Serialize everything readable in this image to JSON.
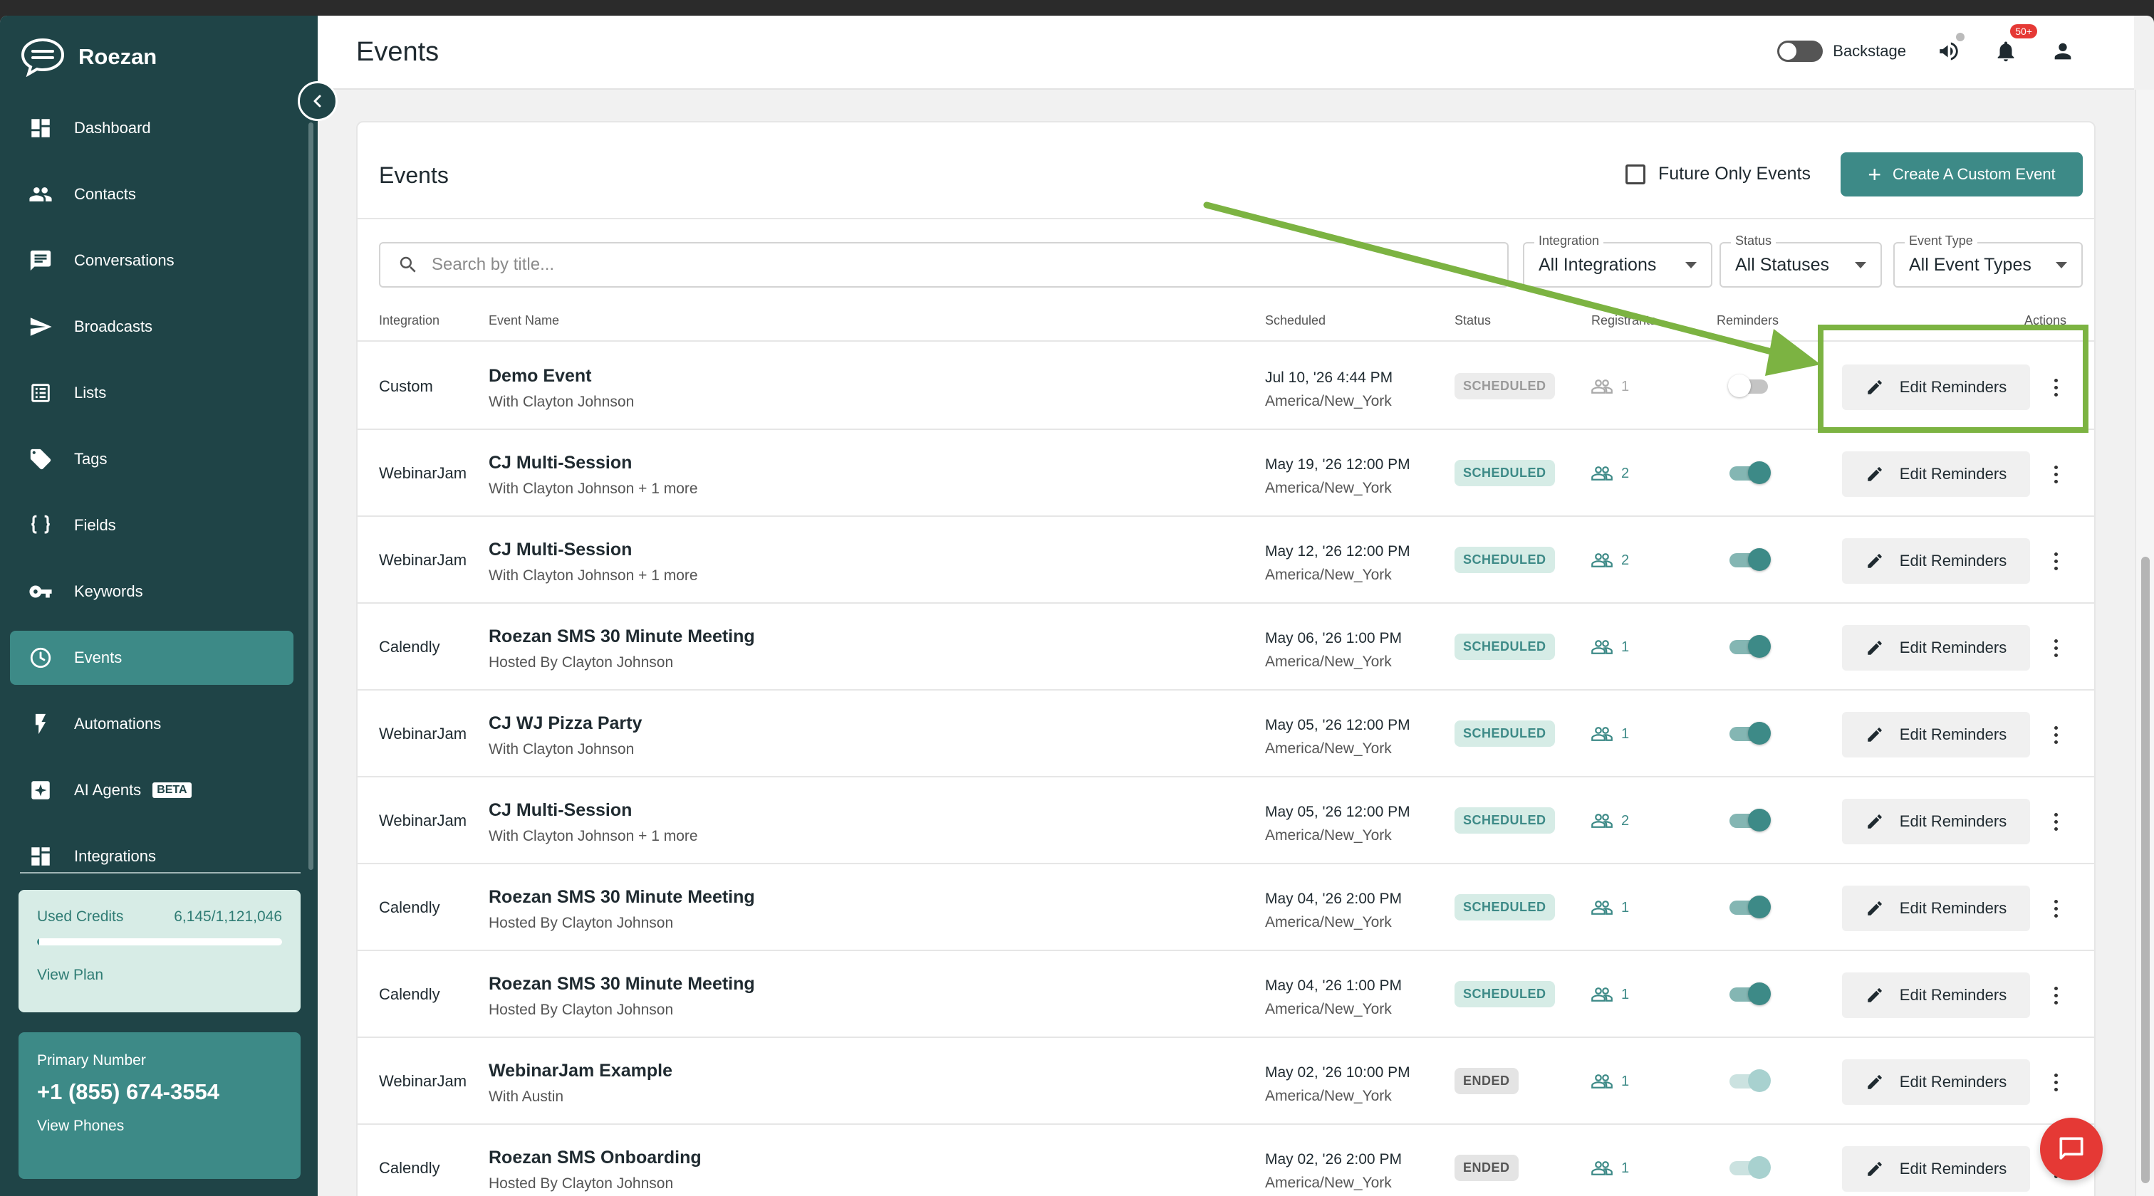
{
  "app": {
    "name": "Roezan"
  },
  "sidebar": {
    "items": [
      {
        "label": "Dashboard",
        "icon": "dashboard-icon"
      },
      {
        "label": "Contacts",
        "icon": "contacts-icon"
      },
      {
        "label": "Conversations",
        "icon": "chat-icon"
      },
      {
        "label": "Broadcasts",
        "icon": "send-icon"
      },
      {
        "label": "Lists",
        "icon": "list-icon"
      },
      {
        "label": "Tags",
        "icon": "tag-icon"
      },
      {
        "label": "Fields",
        "icon": "braces-icon"
      },
      {
        "label": "Keywords",
        "icon": "key-icon"
      },
      {
        "label": "Events",
        "icon": "clock-icon",
        "active": true
      },
      {
        "label": "Automations",
        "icon": "bolt-icon"
      },
      {
        "label": "AI Agents",
        "icon": "sparkle-icon",
        "badge": "BETA"
      },
      {
        "label": "Integrations",
        "icon": "integrations-icon"
      }
    ],
    "credits": {
      "label": "Used Credits",
      "value": "6,145/1,121,046",
      "fraction": 0.0055,
      "link": "View Plan"
    },
    "phone": {
      "label": "Primary Number",
      "number": "+1 (855) 674-3554",
      "link": "View Phones"
    }
  },
  "topbar": {
    "title": "Events",
    "backstage_label": "Backstage",
    "notification_badge": "50+"
  },
  "card": {
    "title": "Events",
    "future_only_label": "Future Only Events",
    "create_button": "Create A Custom Event",
    "search_placeholder": "Search by title...",
    "filters": {
      "integration": {
        "label": "Integration",
        "value": "All Integrations"
      },
      "status": {
        "label": "Status",
        "value": "All Statuses"
      },
      "event_type": {
        "label": "Event Type",
        "value": "All Event Types"
      }
    },
    "columns": {
      "integration": "Integration",
      "event_name": "Event Name",
      "scheduled": "Scheduled",
      "status": "Status",
      "registrants": "Registrants",
      "reminders": "Reminders",
      "actions": "Actions"
    },
    "action_label": "Edit Reminders",
    "rows": [
      {
        "integration": "Custom",
        "title": "Demo Event",
        "subtitle": "With Clayton Johnson",
        "date": "Jul 10, '26 4:44 PM",
        "tz": "America/New_York",
        "status": "SCHEDULED",
        "status_style": "scheduled muted",
        "registrants": "1",
        "reg_style": "muted",
        "reminder": "off"
      },
      {
        "integration": "WebinarJam",
        "title": "CJ Multi-Session",
        "subtitle": "With Clayton Johnson + 1 more",
        "date": "May 19, '26 12:00 PM",
        "tz": "America/New_York",
        "status": "SCHEDULED",
        "status_style": "scheduled",
        "registrants": "2",
        "reg_style": "",
        "reminder": "on"
      },
      {
        "integration": "WebinarJam",
        "title": "CJ Multi-Session",
        "subtitle": "With Clayton Johnson + 1 more",
        "date": "May 12, '26 12:00 PM",
        "tz": "America/New_York",
        "status": "SCHEDULED",
        "status_style": "scheduled",
        "registrants": "2",
        "reg_style": "",
        "reminder": "on"
      },
      {
        "integration": "Calendly",
        "title": "Roezan SMS 30 Minute Meeting",
        "subtitle": "Hosted By Clayton Johnson",
        "date": "May 06, '26 1:00 PM",
        "tz": "America/New_York",
        "status": "SCHEDULED",
        "status_style": "scheduled",
        "registrants": "1",
        "reg_style": "",
        "reminder": "on"
      },
      {
        "integration": "WebinarJam",
        "title": "CJ WJ Pizza Party",
        "subtitle": "With Clayton Johnson",
        "date": "May 05, '26 12:00 PM",
        "tz": "America/New_York",
        "status": "SCHEDULED",
        "status_style": "scheduled",
        "registrants": "1",
        "reg_style": "",
        "reminder": "on"
      },
      {
        "integration": "WebinarJam",
        "title": "CJ Multi-Session",
        "subtitle": "With Clayton Johnson + 1 more",
        "date": "May 05, '26 12:00 PM",
        "tz": "America/New_York",
        "status": "SCHEDULED",
        "status_style": "scheduled",
        "registrants": "2",
        "reg_style": "",
        "reminder": "on"
      },
      {
        "integration": "Calendly",
        "title": "Roezan SMS 30 Minute Meeting",
        "subtitle": "Hosted By Clayton Johnson",
        "date": "May 04, '26 2:00 PM",
        "tz": "America/New_York",
        "status": "SCHEDULED",
        "status_style": "scheduled",
        "registrants": "1",
        "reg_style": "",
        "reminder": "on"
      },
      {
        "integration": "Calendly",
        "title": "Roezan SMS 30 Minute Meeting",
        "subtitle": "Hosted By Clayton Johnson",
        "date": "May 04, '26 1:00 PM",
        "tz": "America/New_York",
        "status": "SCHEDULED",
        "status_style": "scheduled",
        "registrants": "1",
        "reg_style": "",
        "reminder": "on"
      },
      {
        "integration": "WebinarJam",
        "title": "WebinarJam Example",
        "subtitle": "With Austin",
        "date": "May 02, '26 10:00 PM",
        "tz": "America/New_York",
        "status": "ENDED",
        "status_style": "ended",
        "registrants": "1",
        "reg_style": "",
        "reminder": "faded"
      },
      {
        "integration": "Calendly",
        "title": "Roezan SMS Onboarding",
        "subtitle": "Hosted By Clayton Johnson",
        "date": "May 02, '26 2:00 PM",
        "tz": "America/New_York",
        "status": "ENDED",
        "status_style": "ended",
        "registrants": "1",
        "reg_style": "",
        "reminder": "faded"
      }
    ]
  },
  "colors": {
    "sidebar_bg": "#1f4447",
    "accent": "#3d8a87",
    "annotation": "#7cb342",
    "chat_button": "#e53935"
  }
}
